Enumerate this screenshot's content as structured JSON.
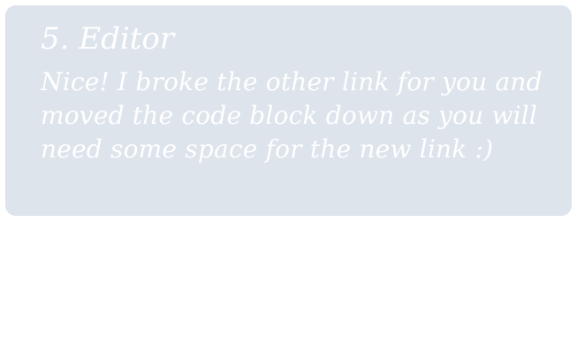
{
  "tip": {
    "title": "5. Editor",
    "body": "Nice! I broke the other link for you and moved the code block down as you will need some space for the new link :)"
  }
}
